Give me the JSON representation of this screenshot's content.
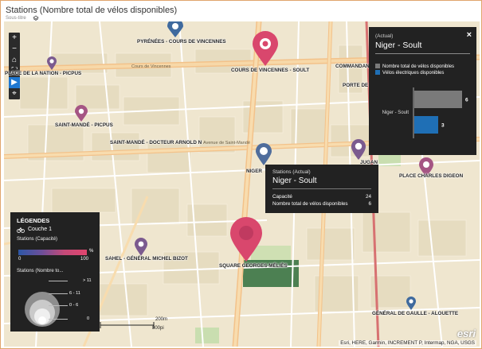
{
  "header": {
    "title": "Stations (Nombre total de vélos disponibles)",
    "subtitle": "Sous-titre"
  },
  "map_labels": {
    "pyrenees": "PYRÉNÉES - COURS DE VINCENNES",
    "soult": "COURS DE VINCENNES - SOULT",
    "nation": "PLACE DE LA NATION - PICPUS",
    "commandant": "COMMANDANT",
    "porte": "PORTE DE VI",
    "stmande_picpus": "SAINT-MANDÉ - PICPUS",
    "stmande_netter": "SAINT-MANDÉ - DOCTEUR ARNOLD N",
    "niger": "NIGER",
    "jugan": "JUGAN",
    "charles_digeon": "PLACE CHARLES DIGEON",
    "sahel": "SAHEL - GÉNÉRAL MICHEL BIZOT",
    "melies": "SQUARE GEORGES MÉLIÈS",
    "gaulle": "GÉNÉRAL DE GAULLE - ALOUETTE",
    "avenue_st_mande": "Avenue de Saint-Mandé",
    "cours_vincennes": "Cours de Vincennes"
  },
  "callout": {
    "subtitle": "(Actual)",
    "title": "Niger - Soult",
    "close_label": "×",
    "legend": [
      {
        "label": "Nombre total de vélos disponibles",
        "color": "#7a7a7a"
      },
      {
        "label": "Vélos électriques disponibles",
        "color": "#1f6fb5"
      }
    ]
  },
  "chart_data": {
    "type": "bar",
    "categories": [
      "Niger - Soult"
    ],
    "series": [
      {
        "name": "Nombre total de vélos disponibles",
        "values": [
          6
        ],
        "color": "#7a7a7a"
      },
      {
        "name": "Vélos électriques disponibles",
        "values": [
          3
        ],
        "color": "#1f6fb5"
      }
    ],
    "ylim": [
      0,
      6
    ]
  },
  "tooltip": {
    "subtitle": "Stations (Actual)",
    "title": "Niger - Soult",
    "rows": [
      {
        "label": "Capacité",
        "value": "24"
      },
      {
        "label": "Nombre total de vélos disponibles",
        "value": "6"
      }
    ]
  },
  "legend": {
    "title": "LÉGENDES",
    "layer": "Couche 1",
    "color_section": "Stations (Capacité)",
    "grad_min": "0",
    "grad_max": "100",
    "grad_unit": "%",
    "size_section": "Stations (Nombre to...",
    "bins": [
      "> 11",
      "6 - 11",
      "0 - 6",
      "0"
    ]
  },
  "scale": {
    "top": "200m",
    "bottom": "800pi"
  },
  "attribution": "Esri, HERE, Garmin, INCREMENT P, Intermap, NGA, USGS",
  "logo": "esri",
  "colors": {
    "accent": "#1f78d1",
    "pin_red": "#d9476d",
    "pin_purple": "#7b5a8f",
    "pin_blue": "#3f6a9e",
    "panel": "#222222"
  }
}
